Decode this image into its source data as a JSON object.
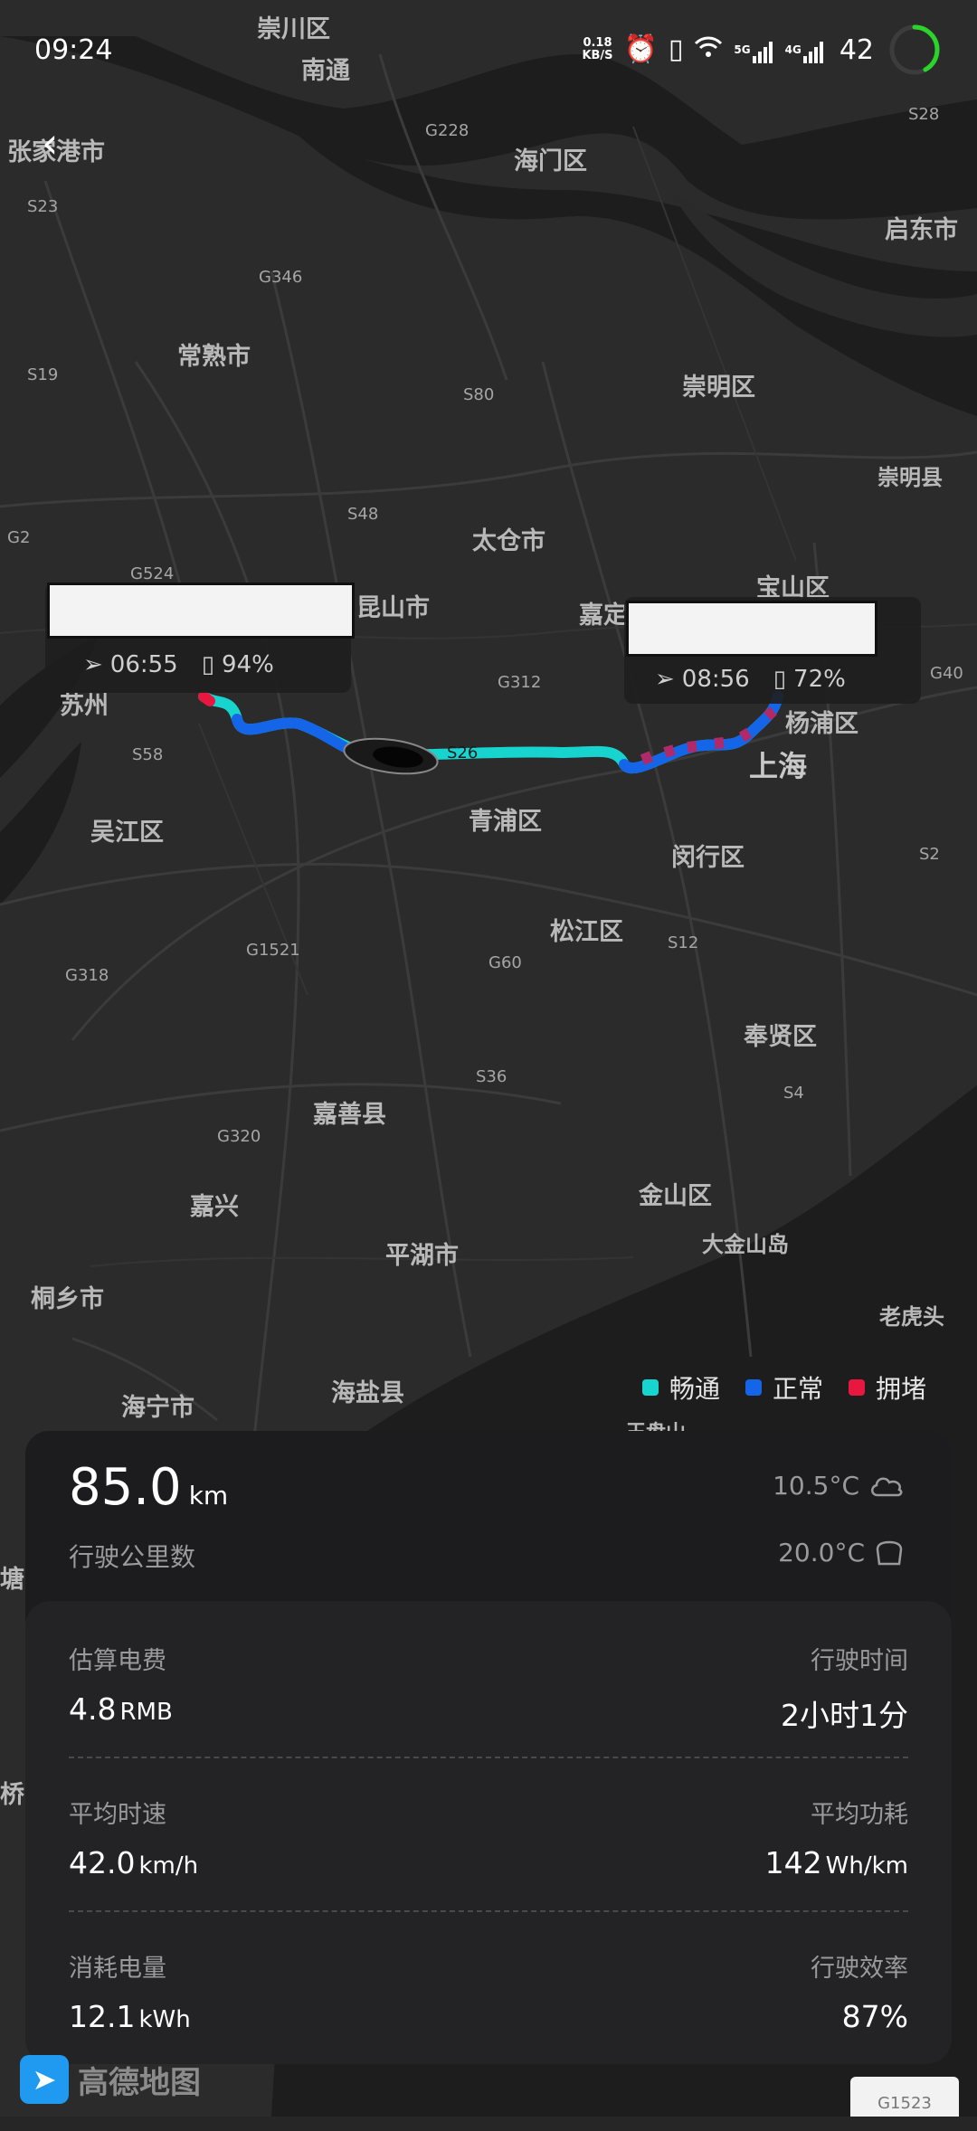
{
  "status_bar": {
    "time": "09:24",
    "net_speed_value": "0.18",
    "net_speed_unit": "KB/S",
    "signal_5g": "5G",
    "signal_4g": "4G",
    "battery_level": "42",
    "battery_fraction": 0.42
  },
  "map": {
    "places": [
      "崇川区",
      "南通",
      "张家港市",
      "海门区",
      "启东市",
      "常熟市",
      "崇明区",
      "崇明县",
      "太仓市",
      "宝山区",
      "昆山市",
      "嘉定",
      "杨浦区",
      "苏州",
      "上海",
      "吴江区",
      "青浦区",
      "闵行区",
      "松江区",
      "奉贤区",
      "嘉善县",
      "嘉兴",
      "金山区",
      "大金山岛",
      "平湖市",
      "桐乡市",
      "老虎头",
      "海宁市",
      "海盐县",
      "王盘山",
      "塘",
      "桥"
    ],
    "roads": [
      "S28",
      "G228",
      "S23",
      "G346",
      "S19",
      "S80",
      "S48",
      "G2",
      "G524",
      "G312",
      "S26",
      "S58",
      "G40",
      "S2",
      "G1521",
      "G318",
      "G60",
      "S12",
      "S36",
      "S4",
      "G320",
      "G1523"
    ]
  },
  "start_point": {
    "time": "06:55",
    "battery": "94%"
  },
  "end_point": {
    "time": "08:56",
    "battery": "72%"
  },
  "legend": [
    {
      "label": "畅通",
      "color": "#18d4cf"
    },
    {
      "label": "正常",
      "color": "#1565e8"
    },
    {
      "label": "拥堵",
      "color": "#e8173f"
    }
  ],
  "summary": {
    "distance_value": "85.0",
    "distance_unit": "km",
    "distance_label": "行驶公里数",
    "outside_temp": "10.5°C",
    "inside_temp": "20.0°C"
  },
  "stats": {
    "cost_label": "估算电费",
    "cost_value": "4.8",
    "cost_unit": "RMB",
    "time_label": "行驶时间",
    "time_value": "2小时1分",
    "speed_label": "平均时速",
    "speed_value": "42.0",
    "speed_unit": "km/h",
    "power_label": "平均功耗",
    "power_value": "142",
    "power_unit": "Wh/km",
    "energy_label": "消耗电量",
    "energy_value": "12.1",
    "energy_unit": "kWh",
    "efficiency_label": "行驶效率",
    "efficiency_value": "87%"
  },
  "map_brand": "高德地图",
  "icons": {
    "back": "back-arrow-icon",
    "nav": "navigation-arrow-icon",
    "battery": "battery-icon",
    "cloud": "cloud-icon",
    "car_seat": "car-interior-icon"
  }
}
